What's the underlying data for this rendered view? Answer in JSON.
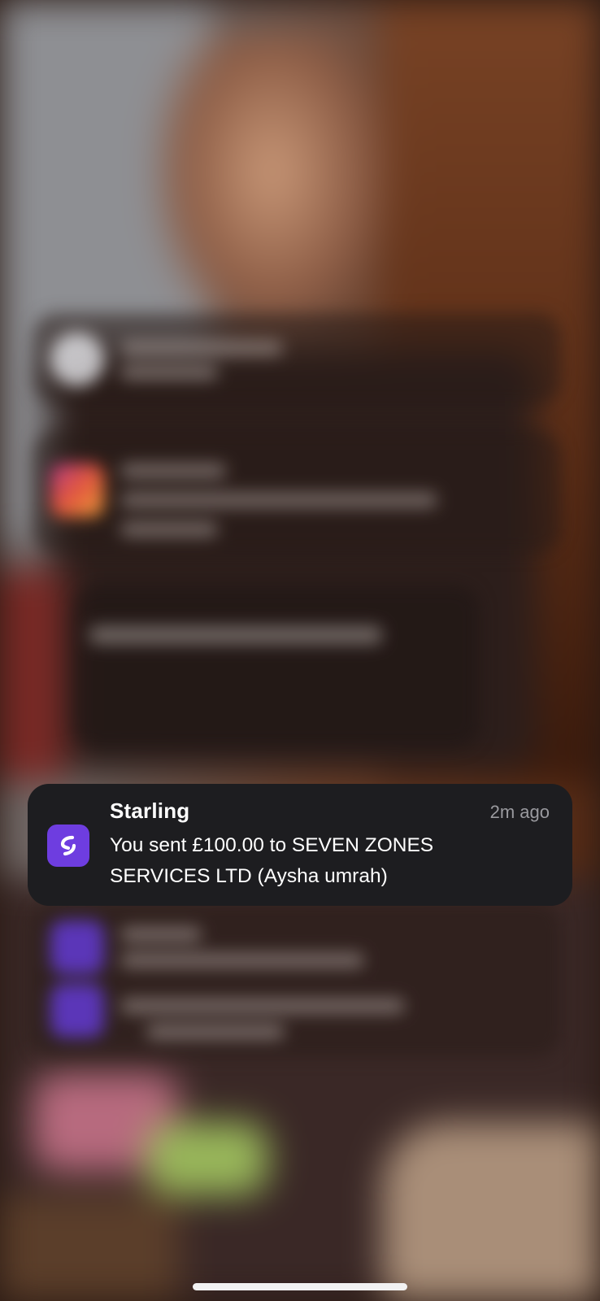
{
  "notification": {
    "app_name": "Starling",
    "timestamp": "2m ago",
    "message": "You sent £100.00 to SEVEN ZONES SERVICES LTD (Aysha umrah)",
    "app_icon": "starling-logo-icon",
    "icon_color": "#6e3de0"
  },
  "colors": {
    "card_background": "#1d1d20",
    "timestamp_text": "#9a9a9f",
    "home_indicator": "#f2f2f2"
  }
}
